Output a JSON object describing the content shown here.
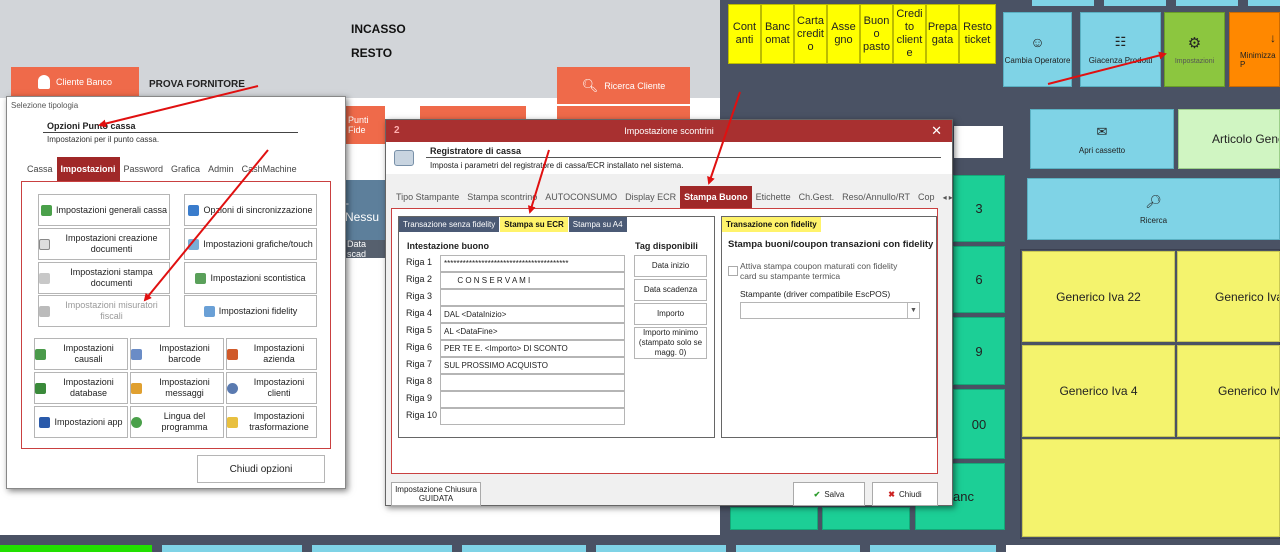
{
  "pos": {
    "incasso_label": "INCASSO",
    "resto_label": "RESTO",
    "cliente_banco": "Cliente Banco",
    "fornitore": "PROVA FORNITORE",
    "ricerca_cliente": "Ricerca Cliente",
    "punti_fide": "Punti Fide",
    "nessu": "- Nessu",
    "data_scad": "Data scad"
  },
  "payments": [
    "Cont anti",
    "Banc omat",
    "Carta credit o",
    "Asse gno",
    "Buon o pasto",
    "Credi to client e",
    "Prepa gata",
    "Resto ticket"
  ],
  "toolbar": {
    "cambia_operatore": "Cambia Operatore",
    "giacenza_prodotti": "Giacenza Prodotti",
    "impostazioni": "Impostazioni",
    "minimizza": "Minimizza P"
  },
  "right": {
    "apri_cassetto": "Apri cassetto",
    "articolo_generico": "Articolo Gener",
    "ricerca": "Ricerca",
    "generico_iva_22": "Generico Iva 22",
    "generico_iva_partial_1": "Generico Iva",
    "generico_iva_4": "Generico Iva 4",
    "generico_iva_partial_2": "Generico Iva",
    "key_3": "3",
    "key_6": "6",
    "key_9": "9",
    "key_00": "00",
    "key_banc": "anc"
  },
  "dlg1": {
    "header": "Selezione tipologia",
    "title": "Opzioni Punto cassa",
    "subtitle": "Impostazioni per il punto cassa.",
    "tabs": [
      "Cassa",
      "Impostazioni",
      "Password",
      "Grafica",
      "Admin",
      "CashMachine"
    ],
    "buttons": {
      "generali": "Impostazioni generali cassa",
      "sincronizzazione": "Opzioni di sincronizzazione",
      "creazione": "Impostazioni creazione documenti",
      "grafiche": "Impostazioni grafiche/touch",
      "stampa": "Impostazioni stampa documenti",
      "scontistica": "Impostazioni scontistica",
      "misuratori": "Impostazioni misuratori fiscali",
      "fidelity": "Impostazioni fidelity",
      "causali": "Impostazioni causali",
      "barcode": "Impostazioni barcode",
      "azienda": "Impostazioni azienda",
      "database": "Impostazioni database",
      "messaggi": "Impostazioni messaggi",
      "clienti": "Impostazioni clienti",
      "app": "Impostazioni app",
      "lingua": "Lingua del programma",
      "trasformazione": "Impostazioni trasformazione"
    },
    "chiudi": "Chiudi opzioni"
  },
  "dlg2": {
    "number": "2",
    "title": "Impostazione scontrini",
    "header_title": "Registratore di cassa",
    "header_sub": "Imposta i parametri del registratore di cassa/ECR installato nel sistema.",
    "tabs": [
      "Tipo Stampante",
      "Stampa scontrino",
      "AUTOCONSUMO",
      "Display ECR",
      "Stampa Buono",
      "Etichette",
      "Ch.Gest.",
      "Reso/Annullo/RT",
      "Cop"
    ],
    "subtabs_left": [
      "Transazione senza fidelity",
      "Stampa su ECR",
      "Stampa su A4"
    ],
    "intestazione": "Intestazione buono",
    "tag_title": "Tag disponibili",
    "rows": [
      {
        "label": "Riga 1",
        "value": "****************************************"
      },
      {
        "label": "Riga 2",
        "value": "      C O N S E R V A M I"
      },
      {
        "label": "Riga 3",
        "value": ""
      },
      {
        "label": "Riga 4",
        "value": "DAL <DataInizio>"
      },
      {
        "label": "Riga 5",
        "value": "AL <DataFine>"
      },
      {
        "label": "Riga 6",
        "value": "PER TE E. <Importo> DI SCONTO"
      },
      {
        "label": "Riga 7",
        "value": "SUL PROSSIMO ACQUISTO"
      },
      {
        "label": "Riga 8",
        "value": ""
      },
      {
        "label": "Riga 9",
        "value": ""
      },
      {
        "label": "Riga 10",
        "value": ""
      }
    ],
    "tags": [
      "Data inizio",
      "Data scadenza",
      "Importo",
      "Importo minimo (stampato solo se magg. 0)"
    ],
    "subtab_right": "Transazione con fidelity",
    "fidelity_title": "Stampa buoni/coupon transazioni con fidelity",
    "checkbox_label": "Attiva stampa coupon maturati con fidelity card su stampante termica",
    "stampante_label": "Stampante (driver compatibile EscPOS)",
    "stampante_value": "",
    "chiusura": "Impostazione Chiusura GUIDATA",
    "salva": "Salva",
    "chiudi": "Chiudi"
  }
}
